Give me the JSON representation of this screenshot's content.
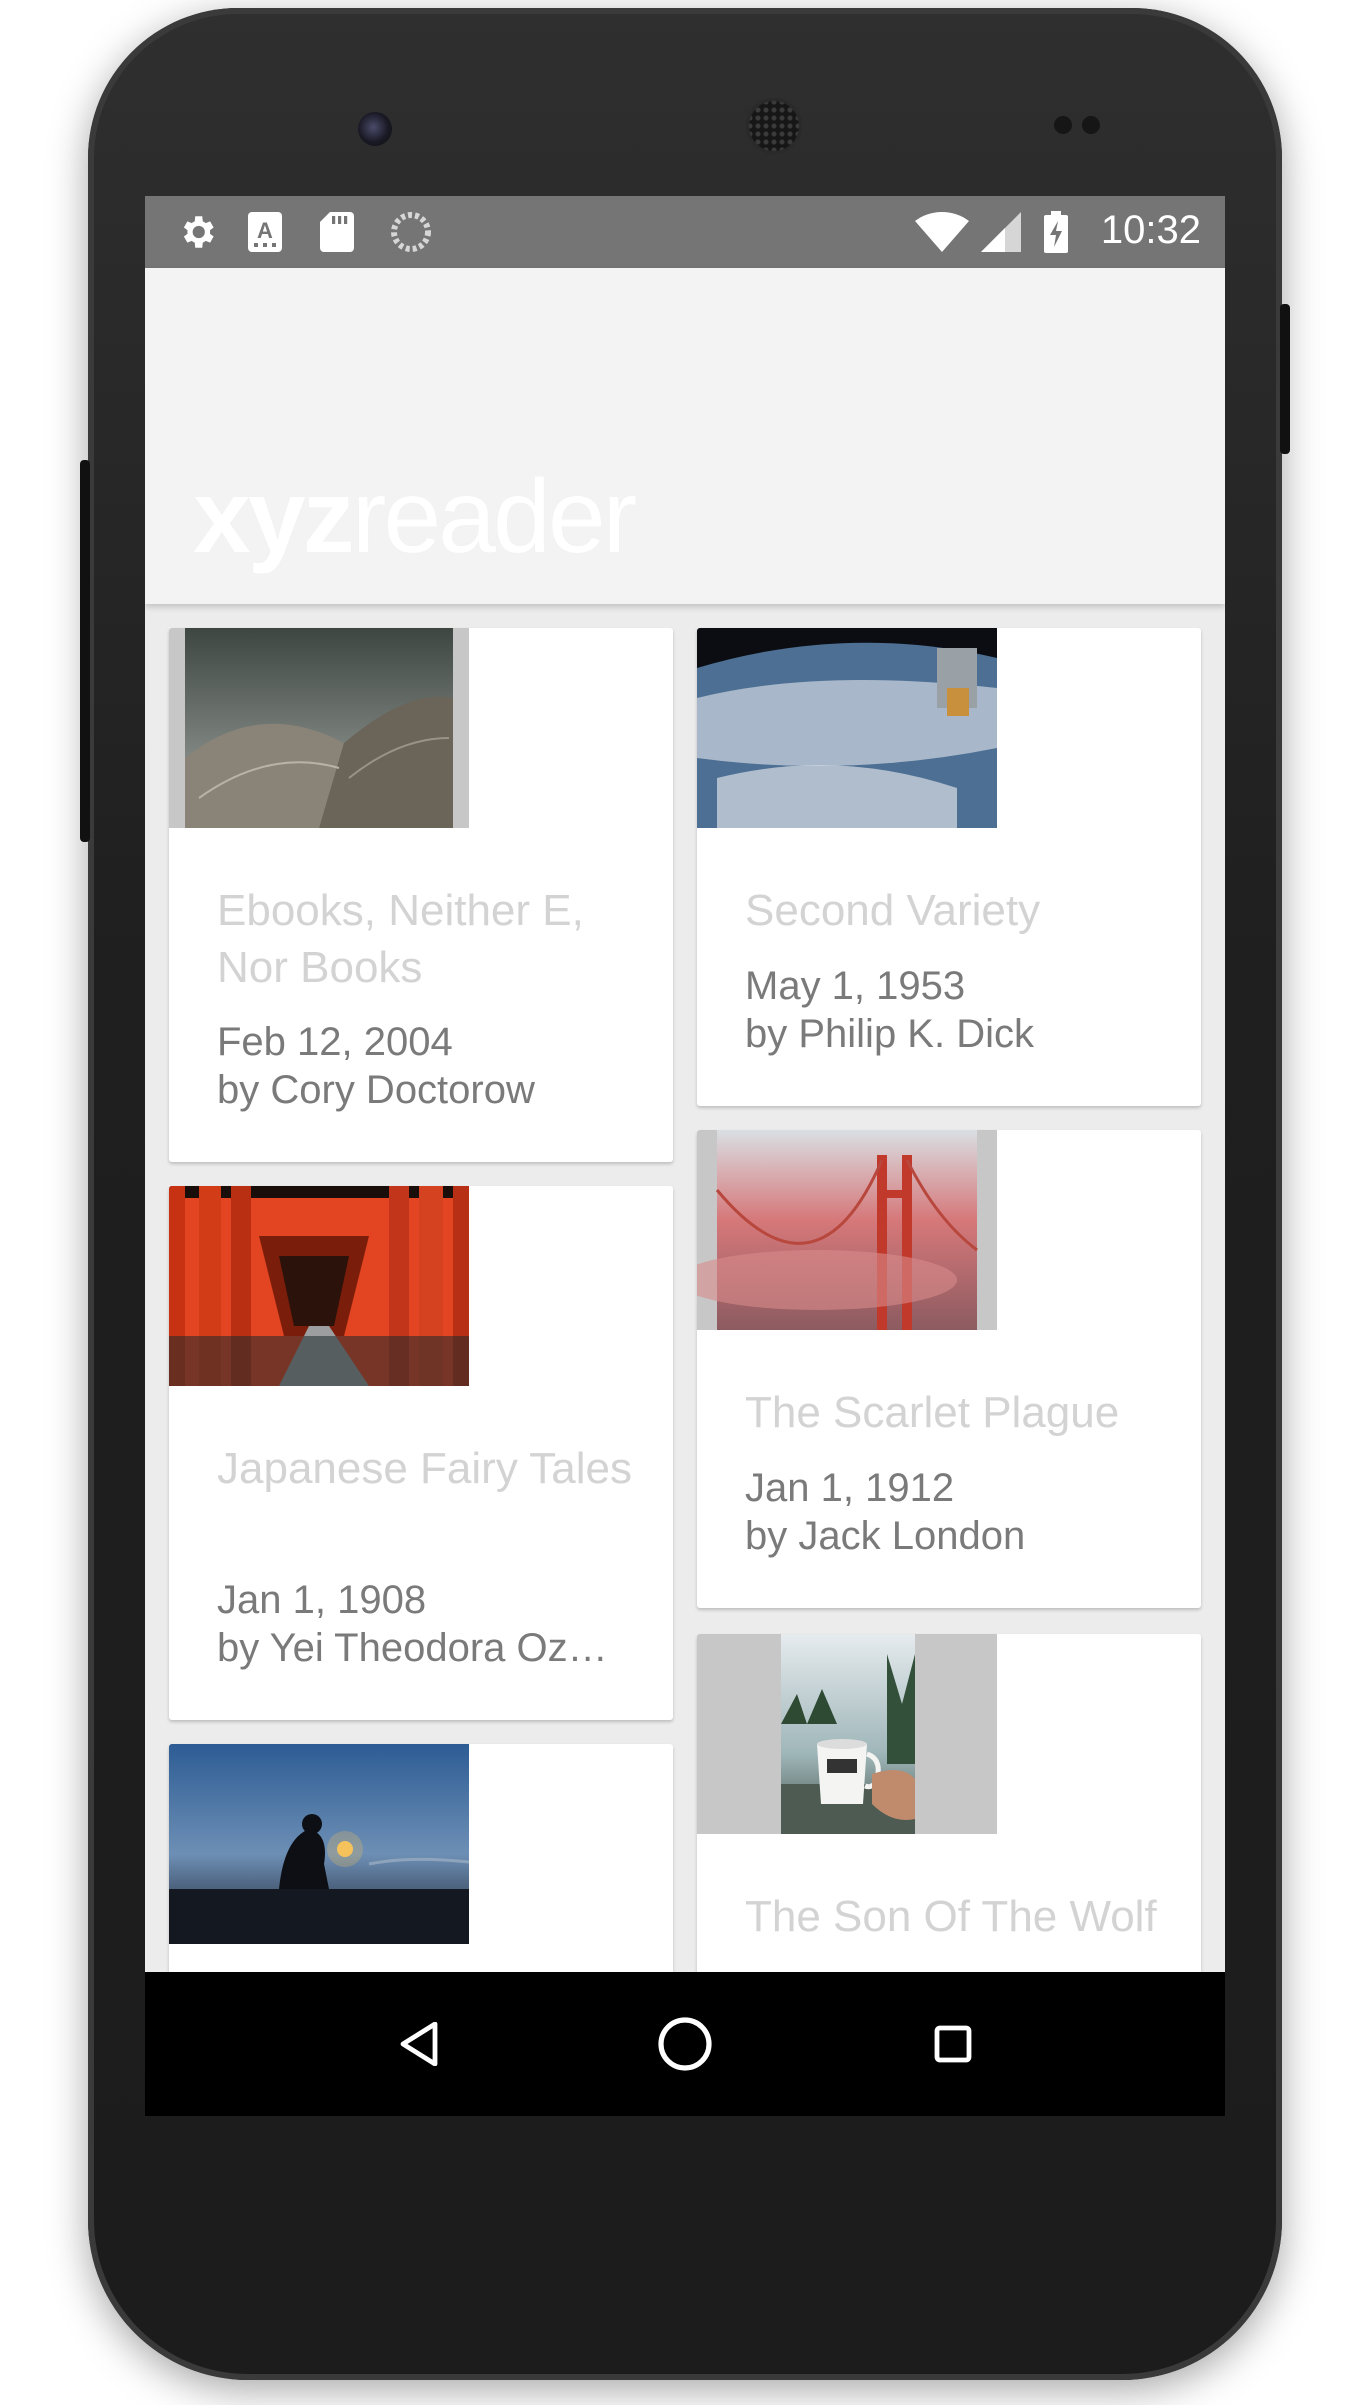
{
  "status_bar": {
    "time": "10:32",
    "left_icons": [
      "gear-icon",
      "text-a-icon",
      "sd-card-icon",
      "sync-icon"
    ],
    "right_icons": [
      "wifi-icon",
      "signal-icon",
      "battery-charging-icon"
    ]
  },
  "app": {
    "logo_bold": "xyz",
    "logo_light": "reader"
  },
  "articles": [
    {
      "title": "Ebooks, Neither E, Nor Books",
      "date": "Feb 12, 2004",
      "author": "by Cory Doctorow",
      "image": "curved-rooftop-image"
    },
    {
      "title": "Second Variety",
      "date": "May 1, 1953",
      "author": "by Philip K. Dick",
      "image": "earth-from-orbit-image"
    },
    {
      "title": "Japanese Fairy Tales",
      "date": "Jan 1, 1908",
      "author": "by Yei Theodora Oz…",
      "image": "torii-gates-image"
    },
    {
      "title": "The Scarlet Plague",
      "date": "Jan 1, 1912",
      "author": "by Jack London",
      "image": "red-fog-bridge-image"
    },
    {
      "title": "",
      "date": "",
      "author": "",
      "image": "lantern-silhouette-image"
    },
    {
      "title": "The Son Of The Wolf",
      "date": "",
      "author": "",
      "image": "camping-mug-image"
    }
  ],
  "nav_bar": {
    "buttons": [
      "back-icon",
      "home-icon",
      "recents-icon"
    ]
  },
  "colors": {
    "status_bar": "#757575",
    "toolbar": "#f3f3f3",
    "title_text": "#d3d3d3",
    "meta_text": "#7a7a7a",
    "nav_bar": "#000000"
  }
}
